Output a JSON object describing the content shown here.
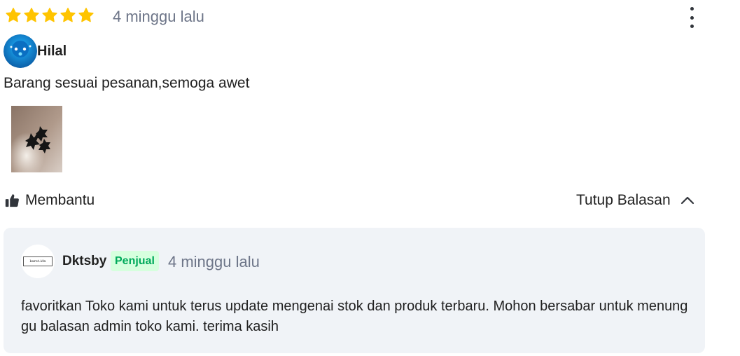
{
  "review": {
    "rating": 5,
    "rating_max": 5,
    "time": "4 minggu lalu",
    "reviewer_name": "Hilal",
    "text": "Barang sesuai pesanan,semoga awet",
    "photo_icon": "product-photo-thumbnail",
    "helpful_label": "Membantu",
    "toggle_reply_label": "Tutup Balasan"
  },
  "reply": {
    "seller_name": "Dktsby",
    "seller_logo_text": "karet.idn",
    "badge": "Penjual",
    "time": "4 minggu lalu",
    "text": "favoritkan Toko kami untuk terus update mengenai stok dan produk terbaru. Mohon bersabar untuk menunggu balasan admin toko kami. terima kasih"
  },
  "colors": {
    "star": "#ffc400",
    "muted_text": "#6d7588",
    "badge_bg": "#d6ffde",
    "badge_text": "#00aa5b",
    "reply_bg": "#f0f3f7"
  }
}
